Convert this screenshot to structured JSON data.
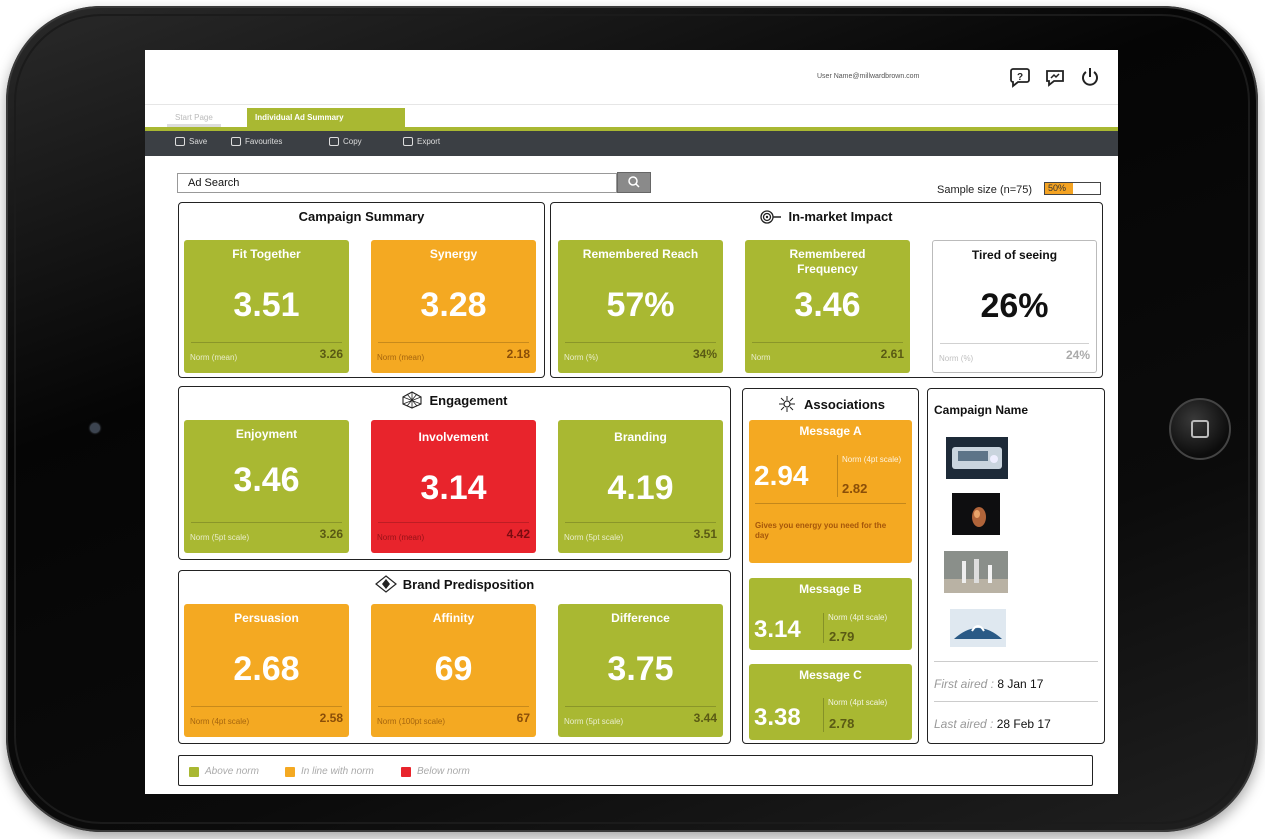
{
  "header": {
    "user": "User Name@millwardbrown.com"
  },
  "tabs": [
    {
      "label": "Start Page"
    },
    {
      "label": "Individual Ad Summary"
    }
  ],
  "toolbar": {
    "save": "Save",
    "favourites": "Favourites",
    "copy": "Copy",
    "export": "Export"
  },
  "search": {
    "placeholder": "Ad Search"
  },
  "sample": {
    "label": "Sample size (n=75)",
    "percent_label": "50%",
    "fill": 0.5
  },
  "campaign_summary": {
    "title": "Campaign Summary",
    "tiles": [
      {
        "label": "Fit Together",
        "value": "3.51",
        "norm_label": "Norm (mean)",
        "norm_value": "3.26",
        "status": "above"
      },
      {
        "label": "Synergy",
        "value": "3.28",
        "norm_label": "Norm (mean)",
        "norm_value": "2.18",
        "status": "inline"
      }
    ]
  },
  "in_market": {
    "title": "In-market Impact",
    "tiles": [
      {
        "label": "Remembered Reach",
        "value": "57%",
        "norm_label": "Norm (%)",
        "norm_value": "34%",
        "status": "above"
      },
      {
        "label": "Remembered Frequency",
        "value": "3.46",
        "norm_label": "Norm",
        "norm_value": "2.61",
        "status": "above"
      },
      {
        "label": "Tired of seeing",
        "value": "26%",
        "norm_label": "Norm (%)",
        "norm_value": "24%",
        "status": "neutral"
      }
    ]
  },
  "engagement": {
    "title": "Engagement",
    "tiles": [
      {
        "label": "Enjoyment",
        "value": "3.46",
        "norm_label": "Norm (5pt scale)",
        "norm_value": "3.26",
        "status": "above"
      },
      {
        "label": "Involvement",
        "value": "3.14",
        "norm_label": "Norm (mean)",
        "norm_value": "4.42",
        "status": "below"
      },
      {
        "label": "Branding",
        "value": "4.19",
        "norm_label": "Norm (5pt scale)",
        "norm_value": "3.51",
        "status": "above"
      }
    ]
  },
  "brand_predisposition": {
    "title": "Brand Predisposition",
    "tiles": [
      {
        "label": "Persuasion",
        "value": "2.68",
        "norm_label": "Norm (4pt scale)",
        "norm_value": "2.58",
        "status": "inline"
      },
      {
        "label": "Affinity",
        "value": "69",
        "norm_label": "Norm (100pt scale)",
        "norm_value": "67",
        "status": "inline"
      },
      {
        "label": "Difference",
        "value": "3.75",
        "norm_label": "Norm (5pt scale)",
        "norm_value": "3.44",
        "status": "above"
      }
    ]
  },
  "associations": {
    "title": "Associations",
    "messages": [
      {
        "label": "Message A",
        "value": "2.94",
        "norm_label": "Norm (4pt scale)",
        "norm_value": "2.82",
        "description": "Gives you energy you need for the day",
        "status": "inline"
      },
      {
        "label": "Message B",
        "value": "3.14",
        "norm_label": "Norm (4pt scale)",
        "norm_value": "2.79",
        "status": "above"
      },
      {
        "label": "Message C",
        "value": "3.38",
        "norm_label": "Norm (4pt scale)",
        "norm_value": "2.78",
        "status": "above"
      }
    ]
  },
  "campaign": {
    "title": "Campaign Name",
    "first_aired_label": "First aired :",
    "first_aired": "8 Jan 17",
    "last_aired_label": "Last aired :",
    "last_aired": "28 Feb 17"
  },
  "legend": {
    "above": "Above norm",
    "inline": "In line with norm",
    "below": "Below norm"
  },
  "colors": {
    "above": "#a9b832",
    "inline": "#f4a922",
    "below": "#e8242c",
    "toolbar": "#3b3f44"
  }
}
